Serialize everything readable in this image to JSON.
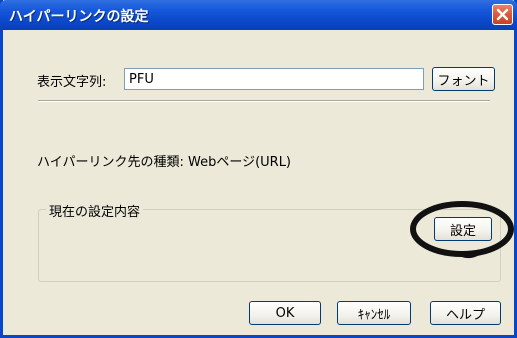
{
  "window": {
    "title": "ハイパーリンクの設定"
  },
  "display_text": {
    "label": "表示文字列:",
    "value": "PFU",
    "font_button": "フォント"
  },
  "link_type": {
    "text": "ハイパーリンク先の種類: Webページ(URL)"
  },
  "current_settings": {
    "group_title": "現在の設定内容",
    "settings_button": "設定"
  },
  "footer": {
    "ok": "OK",
    "cancel": "ｷｬﾝｾﾙ",
    "help": "ヘルプ"
  },
  "colors": {
    "titlebar": "#0a47c8",
    "dialog_bg": "#ece9d8",
    "close_button": "#d95a3a",
    "highlight_ellipse": "#111111"
  },
  "icons": {
    "close": "close-x-icon"
  }
}
